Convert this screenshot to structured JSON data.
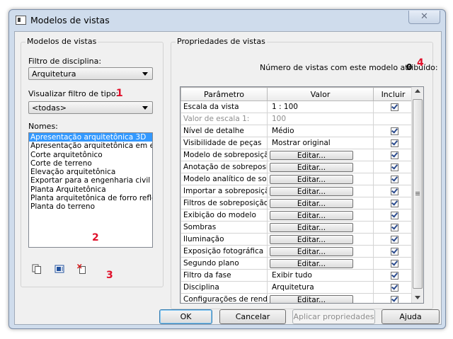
{
  "window": {
    "title": "Modelos de vistas",
    "close_glyph": "✕"
  },
  "left_panel": {
    "group_title": "Modelos de vistas",
    "discipline_filter": {
      "label": "Filtro de disciplina:",
      "value": "Arquitetura"
    },
    "type_filter": {
      "label": "Visualizar filtro de tipo:",
      "value": "<todas>"
    },
    "names": {
      "label": "Nomes:",
      "items": [
        "Apresentação arquitetônica 3D",
        "Apresentação arquitetônica em elevação",
        "Corte arquitetônico",
        "Corte de terreno",
        "Elevação arquitetônica",
        "Exportar para a engenharia civil",
        "Planta Arquitetônica",
        "Planta arquitetônica de forro refletido",
        "Planta do terreno"
      ],
      "selected_index": 0
    },
    "icons": [
      "duplicate-icon",
      "rename-icon",
      "delete-icon"
    ]
  },
  "annotations": {
    "n1": "1",
    "n2": "2",
    "n3": "3",
    "n4": "4"
  },
  "right_panel": {
    "group_title": "Propriedades de vistas",
    "count_label": "Número de vistas com este modelo atribuído:",
    "count_value": "0",
    "columns": [
      "Parâmetro",
      "Valor",
      "Incluir"
    ],
    "rows": [
      {
        "param": "Escala da vista",
        "value": "1 : 100",
        "button": false,
        "include": true,
        "disabled": false
      },
      {
        "param": "Valor de escala   1:",
        "value": "100",
        "button": false,
        "include": null,
        "disabled": true
      },
      {
        "param": "Nível de detalhe",
        "value": "Médio",
        "button": false,
        "include": true,
        "disabled": false
      },
      {
        "param": "Visibilidade de peças",
        "value": "Mostrar original",
        "button": false,
        "include": true,
        "disabled": false
      },
      {
        "param": "Modelo de sobreposição",
        "value": "Editar...",
        "button": true,
        "include": true,
        "disabled": false
      },
      {
        "param": "Anotação de sobreposição",
        "value": "Editar...",
        "button": true,
        "include": true,
        "disabled": false
      },
      {
        "param": "Modelo analítico de sobreposição",
        "value": "Editar...",
        "button": true,
        "include": true,
        "disabled": false
      },
      {
        "param": "Importar a sobreposição",
        "value": "Editar...",
        "button": true,
        "include": true,
        "disabled": false
      },
      {
        "param": "Filtros de sobreposição",
        "value": "Editar...",
        "button": true,
        "include": true,
        "disabled": false
      },
      {
        "param": "Exibição do modelo",
        "value": "Editar...",
        "button": true,
        "include": true,
        "disabled": false
      },
      {
        "param": "Sombras",
        "value": "Editar...",
        "button": true,
        "include": true,
        "disabled": false
      },
      {
        "param": "Iluminação",
        "value": "Editar...",
        "button": true,
        "include": true,
        "disabled": false
      },
      {
        "param": "Exposição fotográfica",
        "value": "Editar...",
        "button": true,
        "include": true,
        "disabled": false
      },
      {
        "param": "Segundo plano",
        "value": "Editar...",
        "button": true,
        "include": true,
        "disabled": false
      },
      {
        "param": "Filtro da fase",
        "value": "Exibir tudo",
        "button": false,
        "include": true,
        "disabled": false
      },
      {
        "param": "Disciplina",
        "value": "Arquitetura",
        "button": false,
        "include": true,
        "disabled": false
      },
      {
        "param": "Configurações de renderização",
        "value": "Editar...",
        "button": true,
        "include": true,
        "disabled": false
      }
    ]
  },
  "footer": {
    "ok": "OK",
    "cancel": "Cancelar",
    "apply": "Aplicar propriedades",
    "help": "Ajuda"
  },
  "colors": {
    "annotation": "#e0102a",
    "selection": "#3399ff",
    "frame": "#cfdcec"
  }
}
